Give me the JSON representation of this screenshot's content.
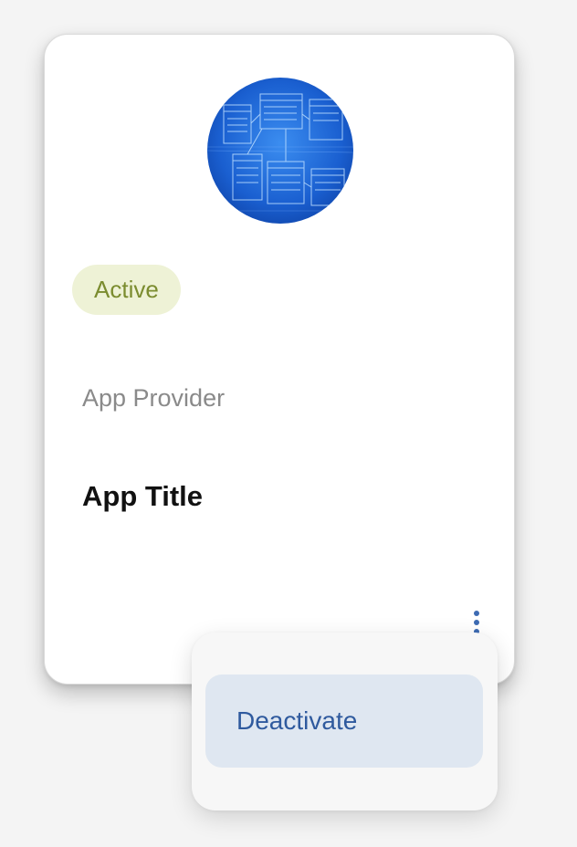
{
  "card": {
    "image_icon": "database-schema-thumbnail",
    "status": "Active",
    "provider": "App Provider",
    "title": "App Title",
    "menu_icon": "kebab-vertical-icon"
  },
  "menu": {
    "items": [
      {
        "label": "Deactivate"
      }
    ]
  },
  "colors": {
    "status_bg": "#eef2d6",
    "status_text": "#7b8c2f",
    "menu_accent": "#2f5a9e",
    "menu_item_bg": "#dfe7f1"
  }
}
